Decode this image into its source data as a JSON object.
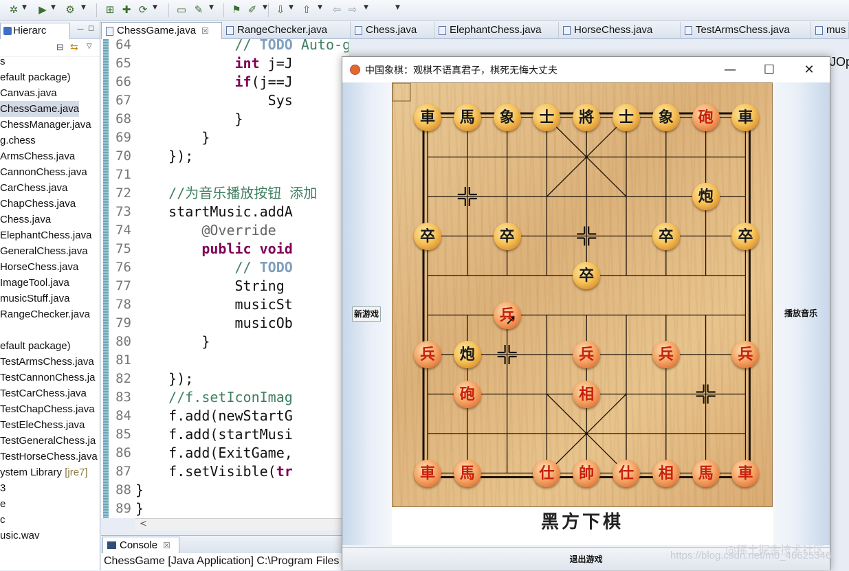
{
  "toolbar": {
    "icons": [
      "debug-icon",
      "run-icon",
      "external-tools-icon",
      "new-package-icon",
      "new-class-icon",
      "refresh-icon",
      "open-folder-icon",
      "pen-icon",
      "pin-icon",
      "highlight-icon",
      "next-annotation-icon",
      "prev-annotation-icon",
      "back-icon",
      "forward-icon"
    ]
  },
  "left_panel": {
    "tab_label": "Hierarc",
    "items": [
      {
        "text": "s",
        "selected": false
      },
      {
        "text": "efault package)",
        "selected": false
      },
      {
        "text": "Canvas.java",
        "selected": false
      },
      {
        "text": "ChessGame.java",
        "selected": true
      },
      {
        "text": "ChessManager.java",
        "selected": false
      },
      {
        "text": "g.chess",
        "selected": false
      },
      {
        "text": "ArmsChess.java",
        "selected": false
      },
      {
        "text": "CannonChess.java",
        "selected": false
      },
      {
        "text": "CarChess.java",
        "selected": false
      },
      {
        "text": "ChapChess.java",
        "selected": false
      },
      {
        "text": "Chess.java",
        "selected": false
      },
      {
        "text": "ElephantChess.java",
        "selected": false
      },
      {
        "text": "GeneralChess.java",
        "selected": false
      },
      {
        "text": "HorseChess.java",
        "selected": false
      },
      {
        "text": "ImageTool.java",
        "selected": false
      },
      {
        "text": "musicStuff.java",
        "selected": false
      },
      {
        "text": "RangeChecker.java",
        "selected": false
      },
      {
        "text": "",
        "selected": false
      },
      {
        "text": "efault package)",
        "selected": false
      },
      {
        "text": "TestArmsChess.java",
        "selected": false
      },
      {
        "text": "TestCannonChess.ja",
        "selected": false
      },
      {
        "text": "TestCarChess.java",
        "selected": false
      },
      {
        "text": "TestChapChess.java",
        "selected": false
      },
      {
        "text": "TestEleChess.java",
        "selected": false
      },
      {
        "text": "TestGeneralChess.ja",
        "selected": false
      },
      {
        "text": "TestHorseChess.java",
        "selected": false
      },
      {
        "text": "ystem Library ",
        "suffix": "[jre7]",
        "selected": false
      },
      {
        "text": "3",
        "selected": false
      },
      {
        "text": "e",
        "selected": false
      },
      {
        "text": "c",
        "selected": false
      },
      {
        "text": "usic.wav",
        "selected": false
      }
    ]
  },
  "editor_tabs": [
    {
      "label": "ChessGame.java",
      "active": true,
      "close": "☒"
    },
    {
      "label": "RangeChecker.java",
      "active": false
    },
    {
      "label": "Chess.java",
      "active": false
    },
    {
      "label": "ElephantChess.java",
      "active": false
    },
    {
      "label": "HorseChess.java",
      "active": false
    },
    {
      "label": "TestArmsChess.java",
      "active": false
    },
    {
      "label": "mus",
      "active": false
    }
  ],
  "code_lines": [
    {
      "num": "64",
      "html": "            <span class=\"cm\">// </span><span class=\"todo\">TODO</span><span class=\"cm\"> Auto-generated method stub</span>"
    },
    {
      "num": "65",
      "html": "            <span class=\"kw\">int</span> j=J"
    },
    {
      "num": "66",
      "html": "            <span class=\"kw\">if</span>(j==J"
    },
    {
      "num": "67",
      "html": "                Sys"
    },
    {
      "num": "68",
      "html": "            }"
    },
    {
      "num": "69",
      "html": "        }"
    },
    {
      "num": "70",
      "html": "    });"
    },
    {
      "num": "71",
      "html": ""
    },
    {
      "num": "72",
      "html": "    <span class=\"cm\">//为音乐播放按钮 添加</span>"
    },
    {
      "num": "73",
      "html": "    startMusic.addA"
    },
    {
      "num": "74",
      "html": "        <span class=\"ann\">@Override</span>"
    },
    {
      "num": "75",
      "html": "        <span class=\"kw\">public</span> <span class=\"kw\">void</span>"
    },
    {
      "num": "76",
      "html": "            <span class=\"cm\">// </span><span class=\"todo\">TODO</span>"
    },
    {
      "num": "77",
      "html": "            String"
    },
    {
      "num": "78",
      "html": "            musicSt"
    },
    {
      "num": "79",
      "html": "            musicOb"
    },
    {
      "num": "80",
      "html": "        }"
    },
    {
      "num": "81",
      "html": ""
    },
    {
      "num": "82",
      "html": "    });"
    },
    {
      "num": "83",
      "html": "    <span class=\"cm\">//f.setIconImag</span>"
    },
    {
      "num": "84",
      "html": "    f.add(newStartG"
    },
    {
      "num": "85",
      "html": "    f.add(startMusi"
    },
    {
      "num": "86",
      "html": "    f.add(ExitGame,"
    },
    {
      "num": "87",
      "html": "    f.setVisible(<span class=\"kw\">tr</span>"
    },
    {
      "num": "88",
      "html": "}"
    },
    {
      "num": "89",
      "html": "}"
    }
  ],
  "console": {
    "tab_label": "Console",
    "launch_line": "ChessGame [Java Application] C:\\Program Files"
  },
  "right_edge_text": "JOp",
  "watermark": "https://blog.csdn.net/m0_46625346",
  "watermark2": "@稀土掘金技术社区",
  "game_window": {
    "title": "中国象棋：观棋不语真君子，棋死无悔大丈夫",
    "new_game_button": "新游戏",
    "play_music_button": "播放音乐",
    "exit_button": "退出游戏",
    "status_text": "黑方下棋",
    "pieces": [
      {
        "char": "車",
        "side": "black",
        "col": 0,
        "row": 0
      },
      {
        "char": "馬",
        "side": "black",
        "col": 1,
        "row": 0
      },
      {
        "char": "象",
        "side": "black",
        "col": 2,
        "row": 0
      },
      {
        "char": "士",
        "side": "black",
        "col": 3,
        "row": 0
      },
      {
        "char": "將",
        "side": "black",
        "col": 4,
        "row": 0
      },
      {
        "char": "士",
        "side": "black",
        "col": 5,
        "row": 0
      },
      {
        "char": "象",
        "side": "black",
        "col": 6,
        "row": 0
      },
      {
        "char": "砲",
        "side": "red",
        "col": 7,
        "row": 0
      },
      {
        "char": "車",
        "side": "black",
        "col": 8,
        "row": 0
      },
      {
        "char": "炮",
        "side": "black",
        "col": 7,
        "row": 2
      },
      {
        "char": "卒",
        "side": "black",
        "col": 0,
        "row": 3
      },
      {
        "char": "卒",
        "side": "black",
        "col": 2,
        "row": 3
      },
      {
        "char": "卒",
        "side": "black",
        "col": 6,
        "row": 3
      },
      {
        "char": "卒",
        "side": "black",
        "col": 8,
        "row": 3
      },
      {
        "char": "卒",
        "side": "black",
        "col": 4,
        "row": 4
      },
      {
        "char": "兵",
        "side": "red",
        "col": 2,
        "row": 5
      },
      {
        "char": "兵",
        "side": "red",
        "col": 0,
        "row": 6
      },
      {
        "char": "炮",
        "side": "black",
        "col": 1,
        "row": 6
      },
      {
        "char": "兵",
        "side": "red",
        "col": 4,
        "row": 6
      },
      {
        "char": "兵",
        "side": "red",
        "col": 6,
        "row": 6
      },
      {
        "char": "兵",
        "side": "red",
        "col": 8,
        "row": 6
      },
      {
        "char": "砲",
        "side": "red",
        "col": 1,
        "row": 7
      },
      {
        "char": "相",
        "side": "red",
        "col": 4,
        "row": 7
      },
      {
        "char": "車",
        "side": "red",
        "col": 0,
        "row": 9
      },
      {
        "char": "馬",
        "side": "red",
        "col": 1,
        "row": 9
      },
      {
        "char": "仕",
        "side": "red",
        "col": 3,
        "row": 9
      },
      {
        "char": "帥",
        "side": "red",
        "col": 4,
        "row": 9
      },
      {
        "char": "仕",
        "side": "red",
        "col": 5,
        "row": 9
      },
      {
        "char": "相",
        "side": "red",
        "col": 6,
        "row": 9
      },
      {
        "char": "馬",
        "side": "red",
        "col": 7,
        "row": 9
      },
      {
        "char": "車",
        "side": "red",
        "col": 8,
        "row": 9
      }
    ],
    "markers": [
      {
        "col": 1,
        "row": 2
      },
      {
        "col": 4,
        "row": 3
      },
      {
        "col": 2,
        "row": 6
      },
      {
        "col": 7,
        "row": 7
      }
    ]
  }
}
